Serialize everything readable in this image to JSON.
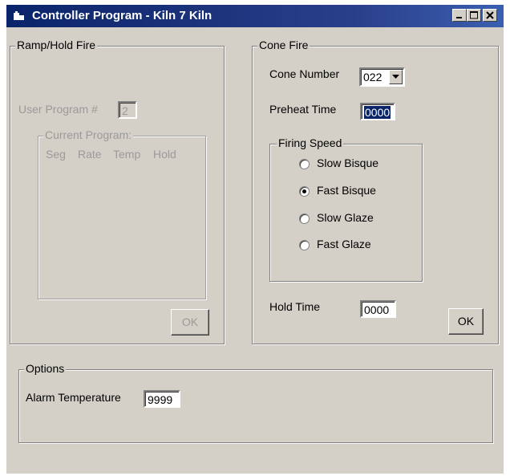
{
  "window": {
    "title": "Controller Program - Kiln 7 Kiln",
    "controls": [
      "minimize-icon",
      "maximize-icon",
      "close-icon"
    ]
  },
  "ramp_hold": {
    "legend": "Ramp/Hold Fire",
    "user_program_label": "User Program #",
    "user_program_value": "2",
    "current_program_legend": "Current Program:",
    "columns": [
      "Seg",
      "Rate",
      "Temp",
      "Hold"
    ],
    "ok_label": "OK"
  },
  "cone_fire": {
    "legend": "Cone Fire",
    "cone_number_label": "Cone Number",
    "cone_number_value": "022",
    "preheat_label": "Preheat Time",
    "preheat_value": "0000",
    "firing_speed": {
      "legend": "Firing Speed",
      "options": [
        "Slow Bisque",
        "Fast Bisque",
        "Slow Glaze",
        "Fast Glaze"
      ],
      "selected": "Fast Bisque"
    },
    "hold_time_label": "Hold Time",
    "hold_time_value": "0000",
    "ok_label": "OK"
  },
  "options": {
    "legend": "Options",
    "alarm_label": "Alarm Temperature",
    "alarm_value": "9999"
  }
}
